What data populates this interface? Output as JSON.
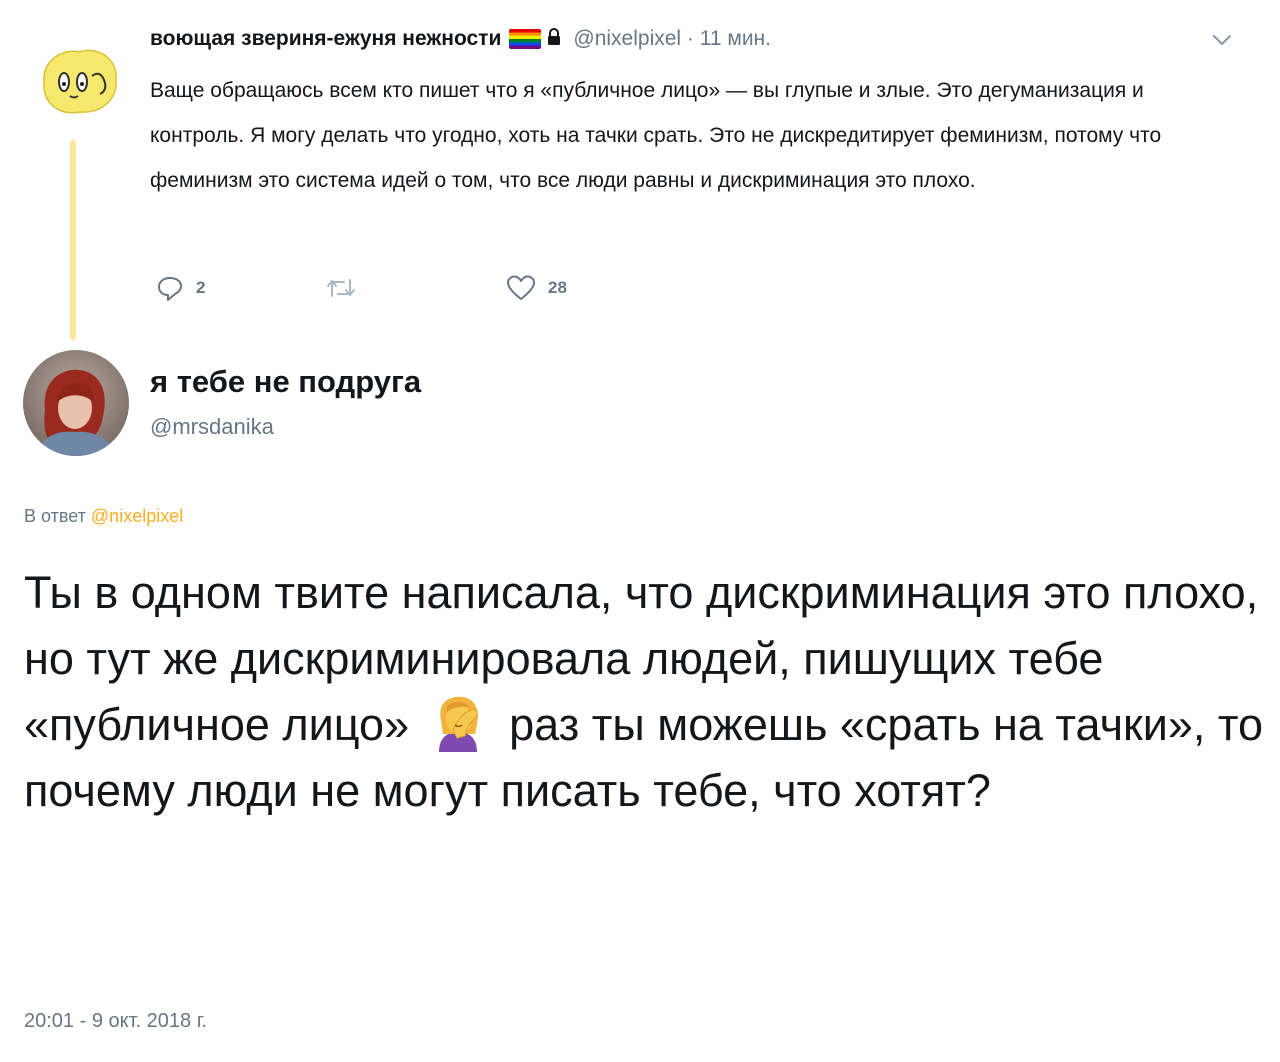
{
  "parent_tweet": {
    "display_name": "воющая звериня-ежуня нежности",
    "flag_icon": "rainbow-flag-icon",
    "lock_icon": "lock-icon",
    "handle_time": "@nixelpixel · 11 мин.",
    "text": "Ваще обращаюсь всем кто пишет что я «публичное лицо» — вы глупые и злые. Это дегуманизация и контроль. Я могу делать что угодно, хоть на тачки срать. Это не дискредитирует феминизм, потому что феминизм это система идей о том, что все люди равны и дискриминация это плохо.",
    "actions": {
      "reply_count": "2",
      "retweet_count": "",
      "like_count": "28"
    }
  },
  "reply_tweet": {
    "display_name": "я тебе не подруга",
    "handle": "@mrsdanika",
    "reply_prefix": "В ответ",
    "reply_mention": "@nixelpixel",
    "text_before_emoji": "Ты в одном твите написала, что дискриминация это плохо, но тут же дискриминировала людей, пишущих тебе «публичное лицо»",
    "emoji": "person-facepalming-emoji",
    "text_after_emoji": "раз ты можешь «срать на тачки», то почему люди не могут писать тебе, что хотят?",
    "timestamp": "20:01 - 9 окт. 2018 г."
  },
  "colors": {
    "text": "#14171a",
    "secondary": "#657786",
    "accent_mention": "#ffad1f",
    "thread_line": "#fae69a"
  }
}
